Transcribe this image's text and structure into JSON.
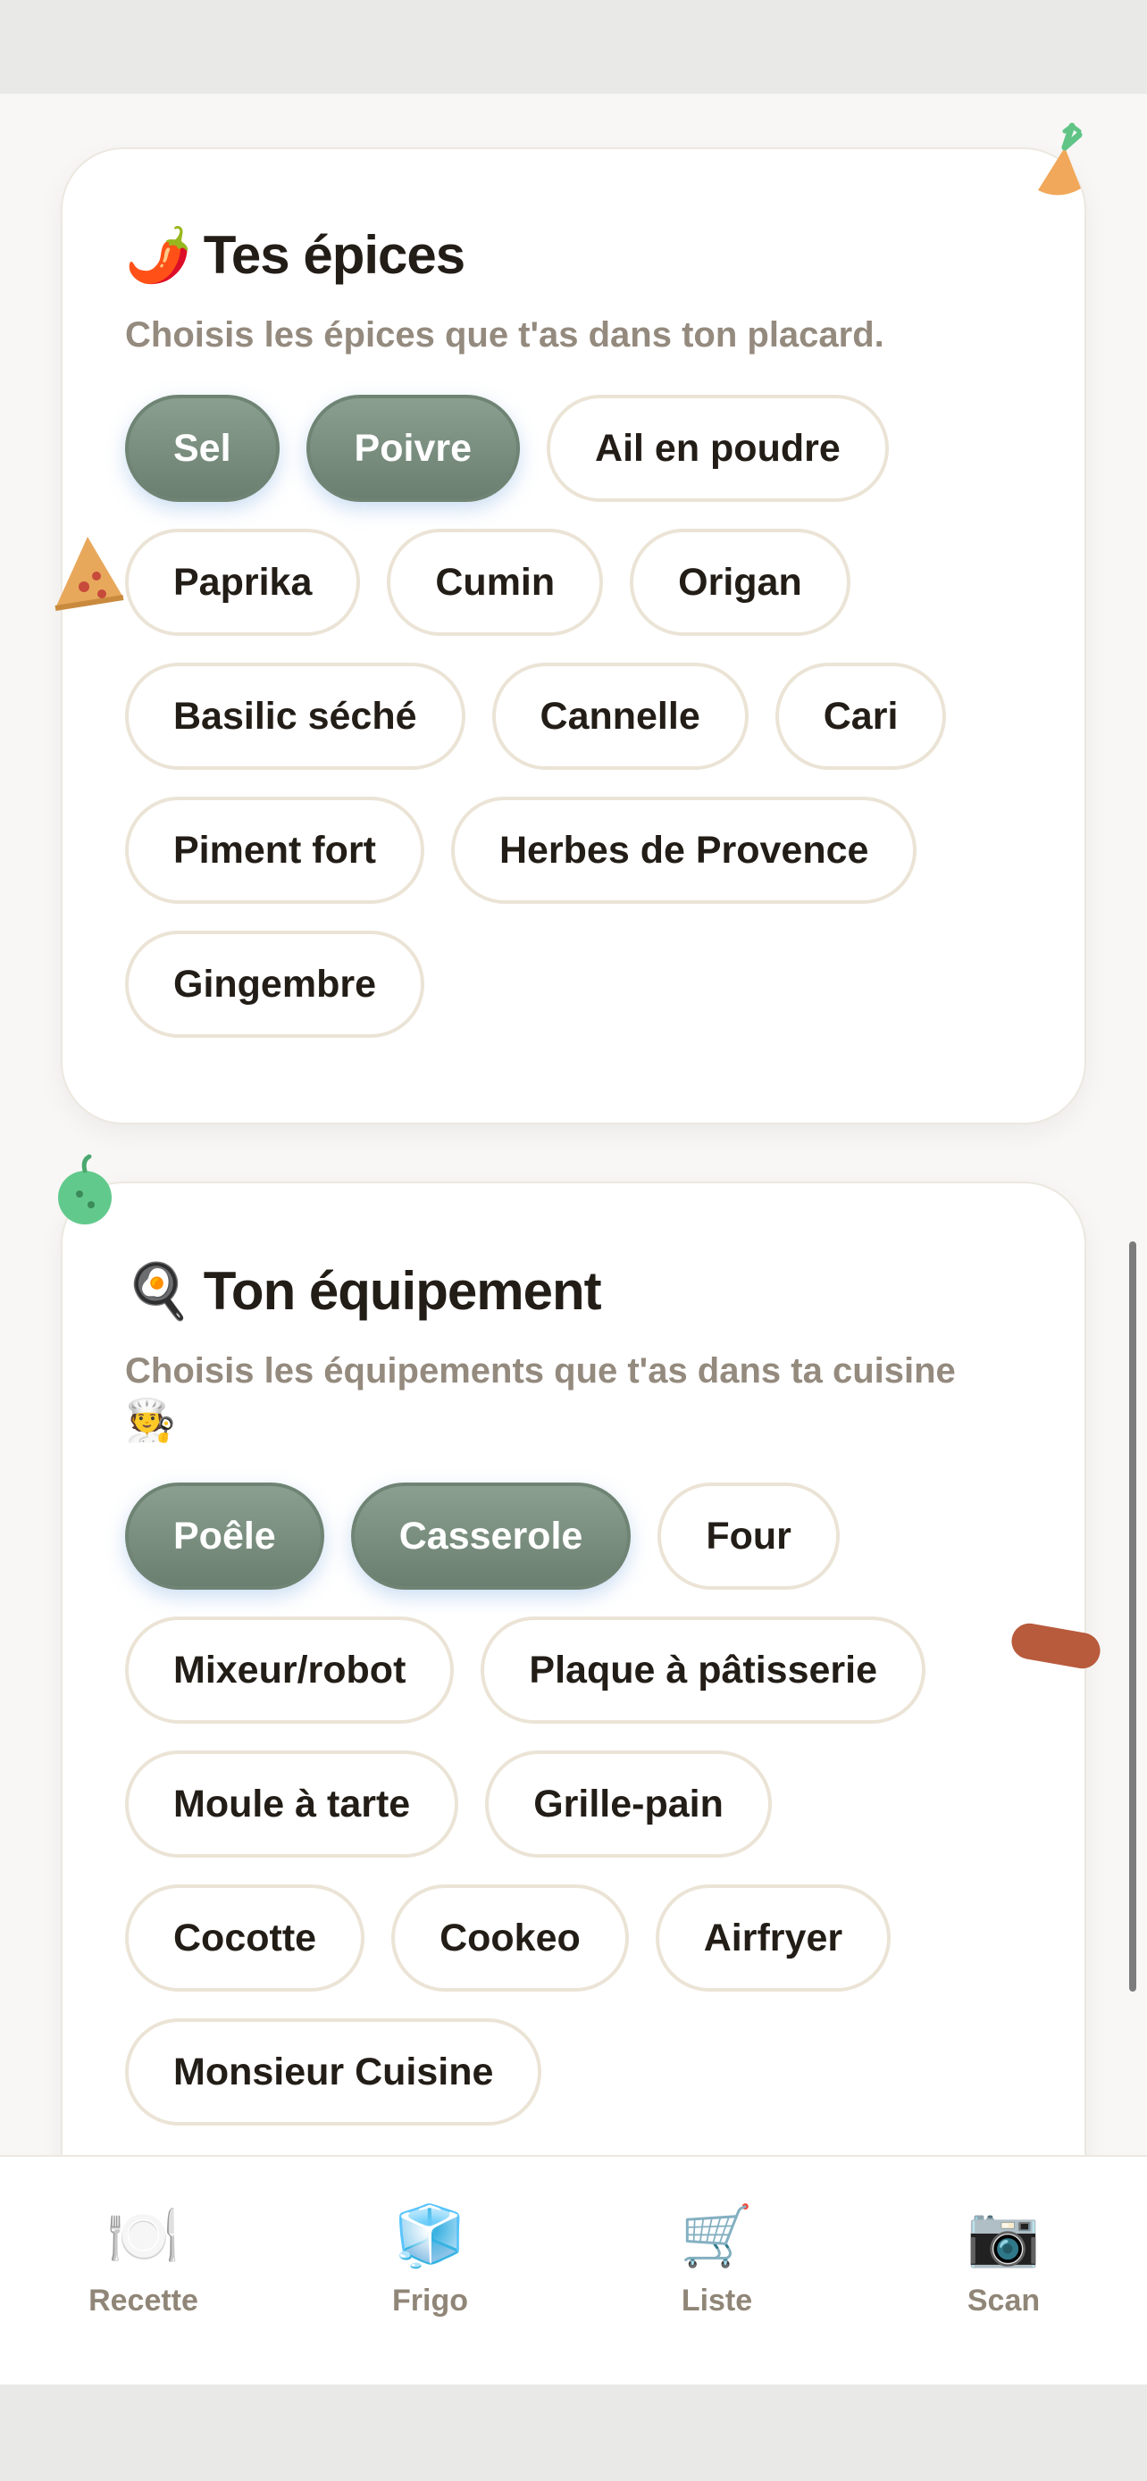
{
  "spices": {
    "emoji": "🌶️",
    "title": "Tes épices",
    "subtitle": "Choisis les épices que t'as dans ton placard.",
    "chips": [
      {
        "label": "Sel",
        "selected": true
      },
      {
        "label": "Poivre",
        "selected": true
      },
      {
        "label": "Ail en poudre",
        "selected": false
      },
      {
        "label": "Paprika",
        "selected": false
      },
      {
        "label": "Cumin",
        "selected": false
      },
      {
        "label": "Origan",
        "selected": false
      },
      {
        "label": "Basilic séché",
        "selected": false
      },
      {
        "label": "Cannelle",
        "selected": false
      },
      {
        "label": "Cari",
        "selected": false
      },
      {
        "label": "Piment fort",
        "selected": false
      },
      {
        "label": "Herbes de Provence",
        "selected": false
      },
      {
        "label": "Gingembre",
        "selected": false
      }
    ]
  },
  "equipment": {
    "emoji": "🍳",
    "title": "Ton équipement",
    "subtitle": "Choisis les équipements que t'as dans ta cuisine",
    "subtitle_emoji": "🧑‍🍳",
    "chips": [
      {
        "label": "Poêle",
        "selected": true
      },
      {
        "label": "Casserole",
        "selected": true
      },
      {
        "label": "Four",
        "selected": false
      },
      {
        "label": "Mixeur/robot",
        "selected": false
      },
      {
        "label": "Plaque à pâtisserie",
        "selected": false
      },
      {
        "label": "Moule à tarte",
        "selected": false
      },
      {
        "label": "Grille-pain",
        "selected": false
      },
      {
        "label": "Cocotte",
        "selected": false
      },
      {
        "label": "Cookeo",
        "selected": false
      },
      {
        "label": "Airfryer",
        "selected": false
      },
      {
        "label": "Monsieur Cuisine",
        "selected": false
      }
    ]
  },
  "tabbar": {
    "items": [
      {
        "label": "Recette",
        "icon": "🍽️",
        "icon_name": "plate-cutlery-icon"
      },
      {
        "label": "Frigo",
        "icon": "🧊",
        "icon_name": "ice-cube-icon"
      },
      {
        "label": "Liste",
        "icon": "🛒",
        "icon_name": "shopping-cart-icon"
      },
      {
        "label": "Scan",
        "icon": "📷",
        "icon_name": "camera-icon"
      }
    ]
  },
  "colors": {
    "selected_chip": "#7a8e7f",
    "chip_border": "#ebe4d6",
    "title": "#231d17",
    "subtitle": "#948a7e"
  }
}
